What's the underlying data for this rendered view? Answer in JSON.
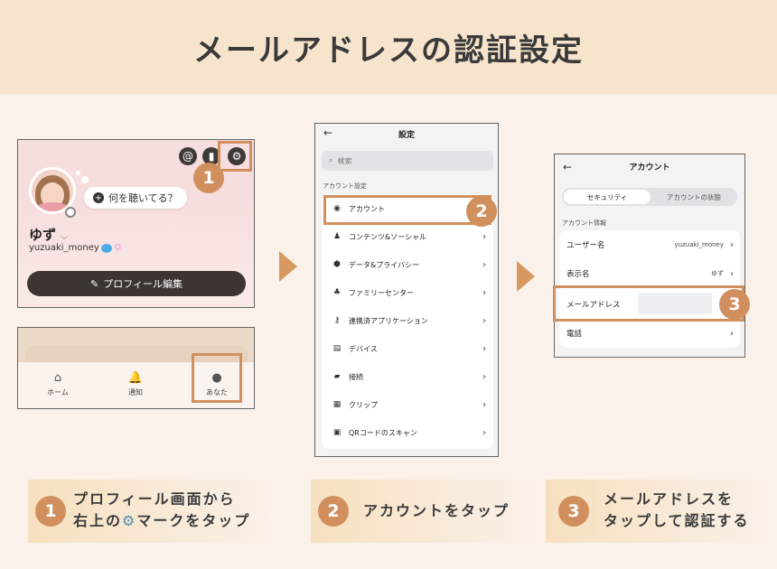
{
  "header": {
    "title": "メールアドレスの認証設定"
  },
  "colors": {
    "accent": "#d28f5e",
    "header_bg": "#f6e4cc",
    "page_bg": "#fbf1eb"
  },
  "profile": {
    "top_icons": [
      "threads-icon",
      "bar-chart-icon",
      "gear-icon"
    ],
    "prompt": "何を聴いてる？",
    "display_name": "ゆず",
    "username": "yuzuaki_money",
    "edit_button": "プロフィール編集"
  },
  "bottom_nav": {
    "items": [
      {
        "label": "ホーム",
        "icon": "home-icon"
      },
      {
        "label": "通知",
        "icon": "bell-icon"
      },
      {
        "label": "あなた",
        "icon": "avatar-icon"
      }
    ]
  },
  "settings": {
    "title": "設定",
    "search_placeholder": "検索",
    "section": "アカウント設定",
    "items": [
      {
        "label": "アカウント",
        "icon": "person-icon"
      },
      {
        "label": "コンテンツ&ソーシャル",
        "icon": "social-icon"
      },
      {
        "label": "データ&プライバシー",
        "icon": "shield-icon"
      },
      {
        "label": "ファミリーセンター",
        "icon": "family-icon"
      },
      {
        "label": "連携済アプリケーション",
        "icon": "key-icon"
      },
      {
        "label": "デバイス",
        "icon": "device-icon"
      },
      {
        "label": "接続",
        "icon": "puzzle-icon"
      },
      {
        "label": "クリップ",
        "icon": "clip-icon"
      },
      {
        "label": "QRコードのスキャン",
        "icon": "qr-icon"
      }
    ]
  },
  "account": {
    "title": "アカウント",
    "tabs": [
      "セキュリティ",
      "アカウントの状態"
    ],
    "section": "アカウント情報",
    "rows": [
      {
        "label": "ユーザー名",
        "value": "yuzuaki_money"
      },
      {
        "label": "表示名",
        "value": "ゆず"
      },
      {
        "label": "メールアドレス",
        "value": ""
      },
      {
        "label": "電話",
        "value": ""
      }
    ]
  },
  "steps": [
    {
      "num": "1",
      "line1": "プロフィール画面から",
      "line2a": "右上の",
      "line2b": "マークをタップ"
    },
    {
      "num": "2",
      "line1": "アカウントをタップ"
    },
    {
      "num": "3",
      "line1": "メールアドレスを",
      "line2": "タップして認証する"
    }
  ]
}
